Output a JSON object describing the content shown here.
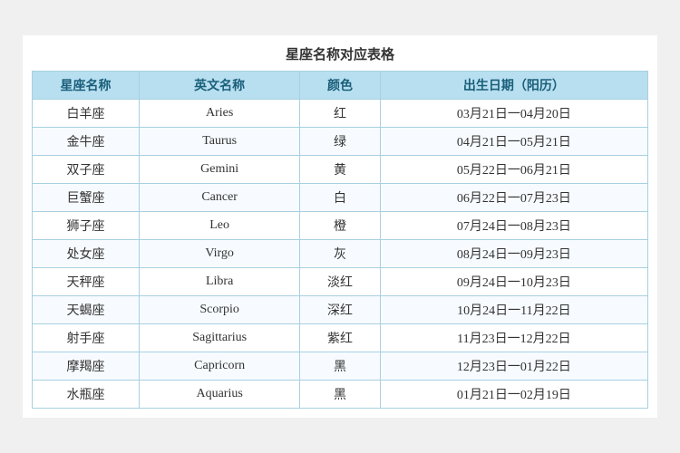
{
  "title": "星座名称对应表格",
  "headers": [
    "星座名称",
    "英文名称",
    "颜色",
    "出生日期（阳历）"
  ],
  "rows": [
    {
      "cn": "白羊座",
      "en": "Aries",
      "color": "红",
      "date": "03月21日一04月20日"
    },
    {
      "cn": "金牛座",
      "en": "Taurus",
      "color": "绿",
      "date": "04月21日一05月21日"
    },
    {
      "cn": "双子座",
      "en": "Gemini",
      "color": "黄",
      "date": "05月22日一06月21日"
    },
    {
      "cn": "巨蟹座",
      "en": "Cancer",
      "color": "白",
      "date": "06月22日一07月23日"
    },
    {
      "cn": "狮子座",
      "en": "Leo",
      "color": "橙",
      "date": "07月24日一08月23日"
    },
    {
      "cn": "处女座",
      "en": "Virgo",
      "color": "灰",
      "date": "08月24日一09月23日"
    },
    {
      "cn": "天秤座",
      "en": "Libra",
      "color": "淡红",
      "date": "09月24日一10月23日"
    },
    {
      "cn": "天蝎座",
      "en": "Scorpio",
      "color": "深红",
      "date": "10月24日一11月22日"
    },
    {
      "cn": "射手座",
      "en": "Sagittarius",
      "color": "紫红",
      "date": "11月23日一12月22日"
    },
    {
      "cn": "摩羯座",
      "en": "Capricorn",
      "color": "黑",
      "date": "12月23日一01月22日"
    },
    {
      "cn": "水瓶座",
      "en": "Aquarius",
      "color": "黑",
      "date": "01月21日一02月19日"
    }
  ]
}
